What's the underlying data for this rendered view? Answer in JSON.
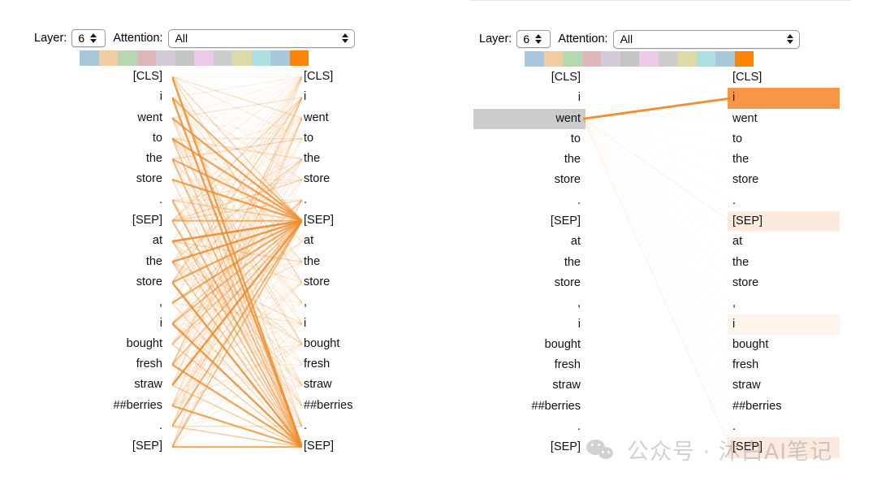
{
  "controls": {
    "layer_label": "Layer:",
    "layer_value": "6",
    "attention_label": "Attention:",
    "attention_value": "All",
    "attention_options": [
      "All"
    ],
    "stepper_up_icon": "triangle-up-icon",
    "stepper_down_icon": "triangle-down-icon",
    "select_arrow_icon": "updown-arrows-icon"
  },
  "swatch_colors": [
    "#a8c6dc",
    "#f2cda2",
    "#b6d8b0",
    "#e0b6bb",
    "#d3cbd8",
    "#c4c4c4",
    "#ecc9e6",
    "#cccccc",
    "#dcdba8",
    "#ade0e0",
    "#a8c8dc",
    "#f98407"
  ],
  "tokens": [
    "[CLS]",
    "i",
    "went",
    "to",
    "the",
    "store",
    ".",
    "[SEP]",
    "at",
    "the",
    "store",
    ",",
    "i",
    "bought",
    "fresh",
    "straw",
    "##berries",
    ".",
    "[SEP]"
  ],
  "panels": [
    {
      "id": "left",
      "mode": "all-attention",
      "source_tokens": [
        "[CLS]",
        "i",
        "went",
        "to",
        "the",
        "store",
        ".",
        "[SEP]",
        "at",
        "the",
        "store",
        ",",
        "i",
        "bought",
        "fresh",
        "straw",
        "##berries",
        ".",
        "[SEP]"
      ],
      "target_tokens": [
        "[CLS]",
        "i",
        "went",
        "to",
        "the",
        "store",
        ".",
        "[SEP]",
        "at",
        "the",
        "store",
        ",",
        "i",
        "bought",
        "fresh",
        "straw",
        "##berries",
        ".",
        "[SEP]"
      ],
      "source_highlights": [],
      "target_highlights": []
    },
    {
      "id": "right",
      "mode": "single-token-selected",
      "selected_source_token": "went",
      "selected_source_index": 2,
      "source_tokens": [
        "[CLS]",
        "i",
        "went",
        "to",
        "the",
        "store",
        ".",
        "[SEP]",
        "at",
        "the",
        "store",
        ",",
        "i",
        "bought",
        "fresh",
        "straw",
        "##berries",
        ".",
        "[SEP]"
      ],
      "target_tokens": [
        "[CLS]",
        "i",
        "went",
        "to",
        "the",
        "store",
        ".",
        "[SEP]",
        "at",
        "the",
        "store",
        ",",
        "i",
        "bought",
        "fresh",
        "straw",
        "##berries",
        ".",
        "[SEP]"
      ],
      "source_highlights": [
        {
          "index": 2,
          "color": "#cccccc"
        }
      ],
      "target_highlights": [
        {
          "index": 1,
          "color": "#f79646",
          "label": "i",
          "weight": 1.0
        },
        {
          "index": 7,
          "color": "#fbeadd",
          "label": "[SEP]",
          "weight": 0.12
        },
        {
          "index": 12,
          "color": "#fdf4ec",
          "label": "i",
          "weight": 0.06
        },
        {
          "index": 18,
          "color": "#fbeadd",
          "label": "[SEP]",
          "weight": 0.12
        }
      ]
    }
  ],
  "colors": {
    "attention_line": "#ed8b2a",
    "selected_source_bg": "#cccccc",
    "selected_target_bg": "#f79646",
    "faint_target_bg": "#fbeadd",
    "text": "#111111",
    "page_bg": "#ffffff"
  },
  "watermark": {
    "icon": "wechat-icon",
    "text": "公众号 · 沐白AI笔记"
  }
}
